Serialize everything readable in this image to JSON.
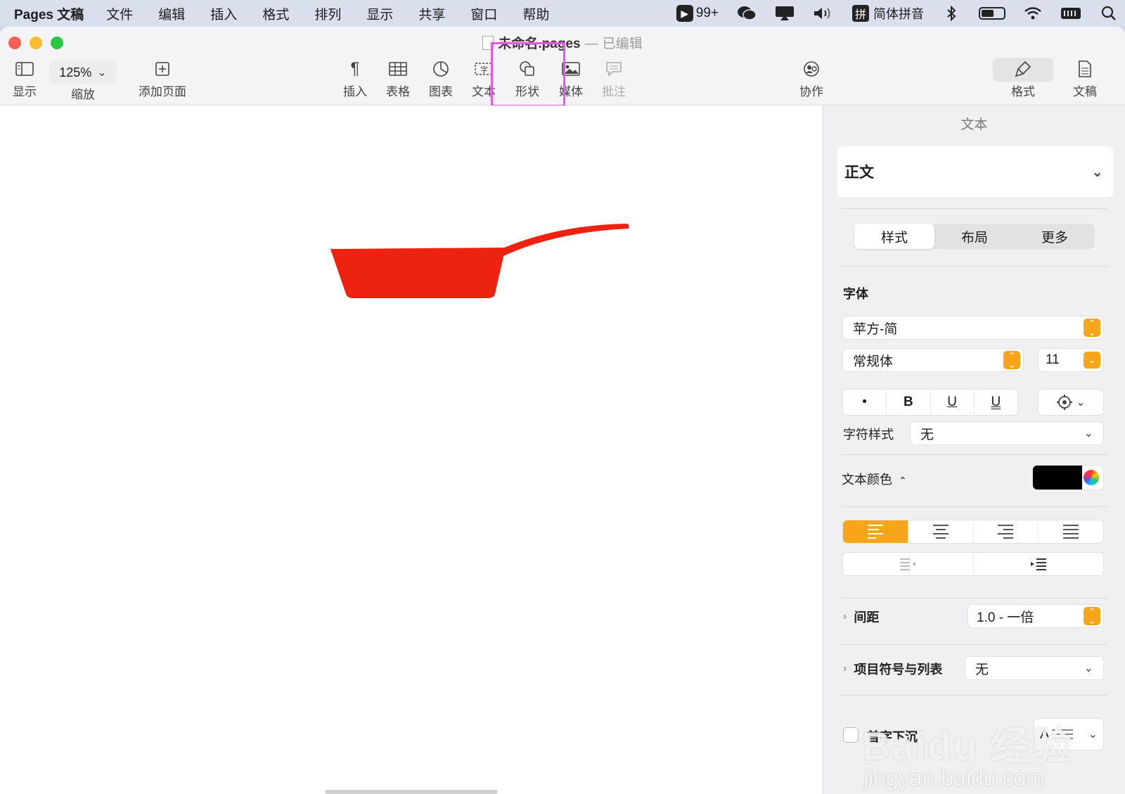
{
  "menubar": {
    "app_name": "Pages 文稿",
    "items": [
      "文件",
      "编辑",
      "插入",
      "格式",
      "排列",
      "显示",
      "共享",
      "窗口",
      "帮助"
    ],
    "badge_count": "99+",
    "ime_label": "简体拼音",
    "ime_glyph": "拼",
    "battery_level": 0.55
  },
  "window": {
    "title": "未命名.pages",
    "title_separator": "—",
    "title_state": "已编辑"
  },
  "toolbar": {
    "view_label": "显示",
    "zoom_value": "125%",
    "zoom_label": "缩放",
    "add_page_label": "添加页面",
    "insert_label": "插入",
    "table_label": "表格",
    "chart_label": "图表",
    "text_label": "文本",
    "shape_label": "形状",
    "media_label": "媒体",
    "comment_label": "批注",
    "collaborate_label": "协作",
    "format_label": "格式",
    "document_label": "文稿"
  },
  "inspector": {
    "header": "文本",
    "paragraph_style": "正文",
    "tabs": [
      {
        "label": "样式",
        "active": true
      },
      {
        "label": "布局",
        "active": false
      },
      {
        "label": "更多",
        "active": false
      }
    ],
    "font_section": "字体",
    "font_family": "苹方-简",
    "font_weight": "常规体",
    "font_size": "11",
    "style_buttons": {
      "bullet": "•",
      "bold": "B",
      "underline": "U",
      "underline2": "U"
    },
    "char_style_label": "字符样式",
    "char_style_value": "无",
    "text_color_label": "文本颜色",
    "text_color_arrow": "⌃",
    "text_color": "#000000",
    "spacing_label": "间距",
    "spacing_value": "1.0 - 一倍",
    "bullets_label": "项目符号与列表",
    "bullets_value": "无",
    "dropcap_label": "首字下沉",
    "dropcap_glyph": "A"
  },
  "canvas": {
    "shape_color": "#ee2211"
  },
  "watermark": {
    "main": "Baidu 经验",
    "sub": "jingyan.baidu.com"
  }
}
